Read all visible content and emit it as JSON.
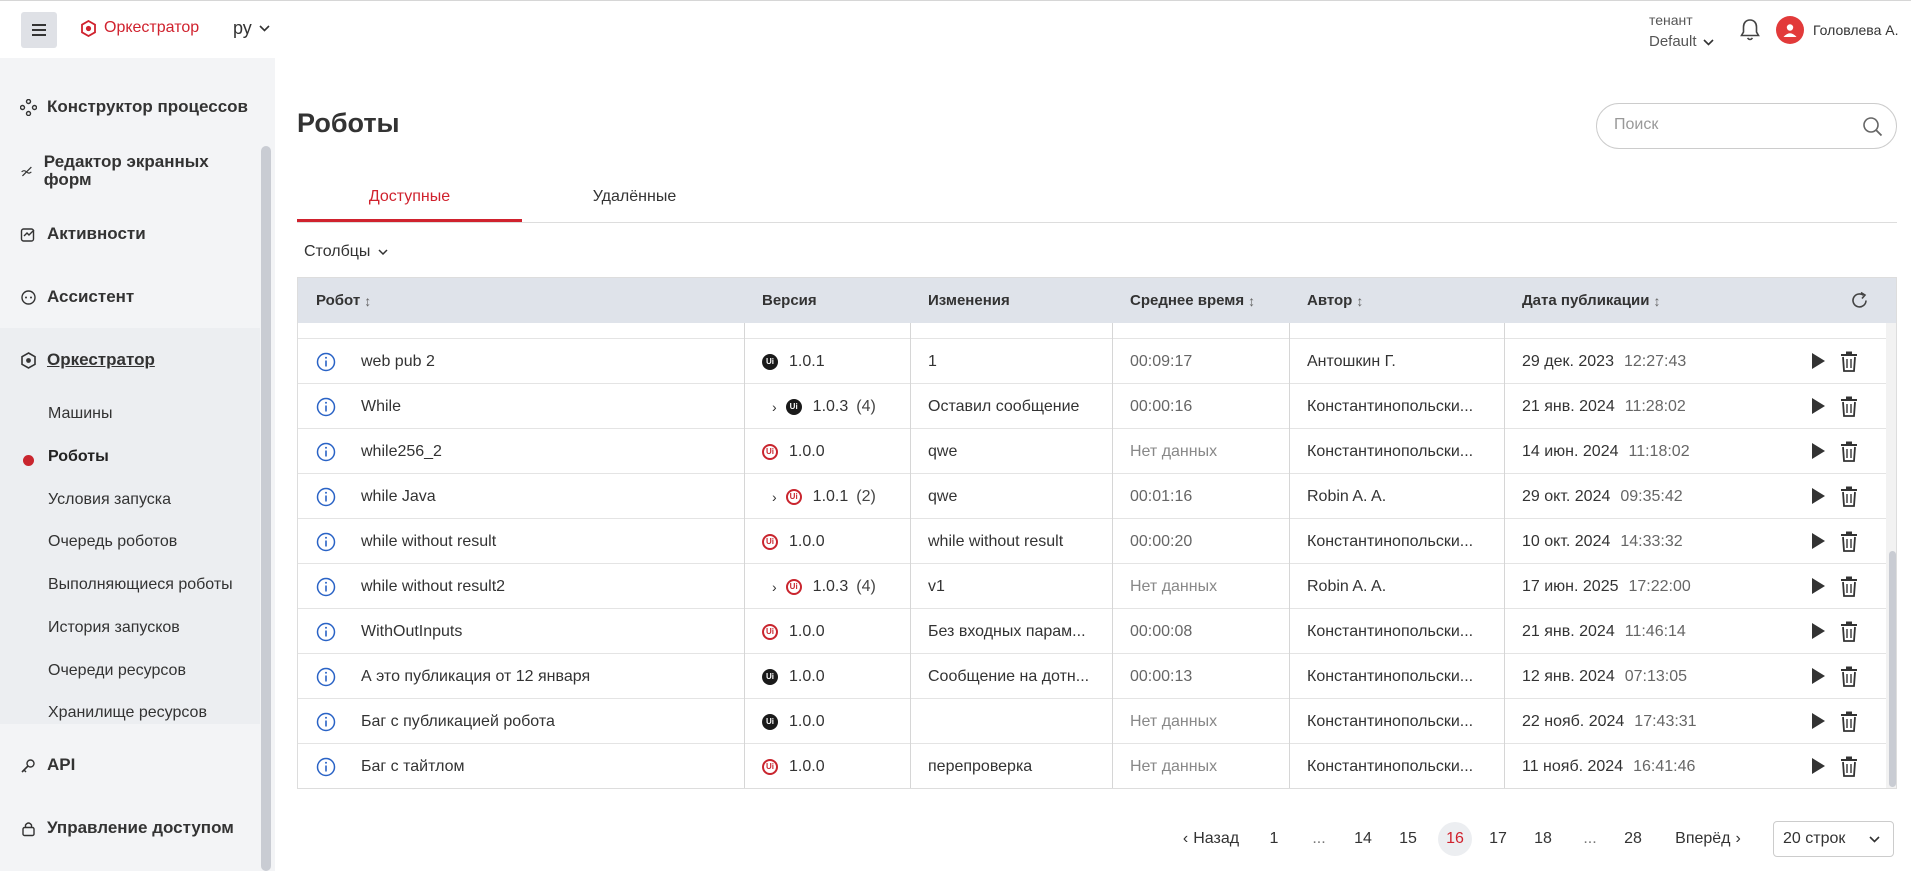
{
  "header": {
    "logo_text": "Оркестратор",
    "language": "ру",
    "tenant_label": "тенант",
    "tenant_value": "Default",
    "user_name": "Головлева А."
  },
  "sidebar": {
    "items": [
      {
        "label": "Конструктор процессов",
        "icon": "process-builder-icon"
      },
      {
        "label": "Редактор экранных форм",
        "icon": "form-editor-icon"
      },
      {
        "label": "Активности",
        "icon": "activity-icon"
      },
      {
        "label": "Ассистент",
        "icon": "assistant-icon"
      },
      {
        "label": "Оркестратор",
        "icon": "orchestrator-icon"
      },
      {
        "label": "API",
        "icon": "api-icon"
      },
      {
        "label": "Управление доступом",
        "icon": "access-icon"
      }
    ],
    "orchestrator_sub": [
      "Машины",
      "Роботы",
      "Условия запуска",
      "Очередь роботов",
      "Выполняющиеся роботы",
      "История запусков",
      "Очереди ресурсов",
      "Хранилище ресурсов"
    ],
    "active_sub": "Роботы"
  },
  "main": {
    "title": "Роботы",
    "search_placeholder": "Поиск",
    "tabs": [
      "Доступные",
      "Удалённые"
    ],
    "columns_label": "Столбцы",
    "table_headers": [
      "Робот",
      "Версия",
      "Изменения",
      "Среднее время",
      "Автор",
      "Дата публикации"
    ],
    "rows": [
      {
        "name": "web pub 2",
        "badge": "dark",
        "version": "1.0.1",
        "count": "",
        "changes": "1",
        "avg": "00:09:17",
        "avg_muted": false,
        "author": "Антошкин Г.",
        "date": "29 дек. 2023",
        "time": "12:27:43"
      },
      {
        "name": "While",
        "badge": "dark",
        "version": "1.0.3",
        "count": "(4)",
        "changes": "Оставил сообщение",
        "avg": "00:00:16",
        "avg_muted": false,
        "author": "Константинопольски...",
        "date": "21 янв. 2024",
        "time": "11:28:02"
      },
      {
        "name": "while256_2",
        "badge": "red",
        "version": "1.0.0",
        "count": "",
        "changes": "qwe",
        "avg": "Нет данных",
        "avg_muted": true,
        "author": "Константинопольски...",
        "date": "14 июн. 2024",
        "time": "11:18:02"
      },
      {
        "name": "while Java",
        "badge": "red",
        "version": "1.0.1",
        "count": "(2)",
        "changes": "qwe",
        "avg": "00:01:16",
        "avg_muted": false,
        "author": "Robin A. A.",
        "date": "29 окт. 2024",
        "time": "09:35:42"
      },
      {
        "name": "while without result",
        "badge": "red",
        "version": "1.0.0",
        "count": "",
        "changes": "while without result",
        "avg": "00:00:20",
        "avg_muted": false,
        "author": "Константинопольски...",
        "date": "10 окт. 2024",
        "time": "14:33:32"
      },
      {
        "name": "while without result2",
        "badge": "red",
        "version": "1.0.3",
        "count": "(4)",
        "changes": "v1",
        "avg": "Нет данных",
        "avg_muted": true,
        "author": "Robin A. A.",
        "date": "17 июн. 2025",
        "time": "17:22:00"
      },
      {
        "name": "WithOutInputs",
        "badge": "red",
        "version": "1.0.0",
        "count": "",
        "changes": "Без входных парам...",
        "avg": "00:00:08",
        "avg_muted": false,
        "author": "Константинопольски...",
        "date": "21 янв. 2024",
        "time": "11:46:14"
      },
      {
        "name": "А это публикация от 12 января",
        "badge": "dark",
        "version": "1.0.0",
        "count": "",
        "changes": "Сообщение на дотн...",
        "avg": "00:00:13",
        "avg_muted": false,
        "author": "Константинопольски...",
        "date": "12 янв. 2024",
        "time": "07:13:05"
      },
      {
        "name": "Баг с публикацией робота",
        "badge": "dark",
        "version": "1.0.0",
        "count": "",
        "changes": "",
        "avg": "Нет данных",
        "avg_muted": true,
        "author": "Константинопольски...",
        "date": "22 нояб. 2024",
        "time": "17:43:31"
      },
      {
        "name": "Баг с тайтлом",
        "badge": "red",
        "version": "1.0.0",
        "count": "",
        "changes": "перепроверка",
        "avg": "Нет данных",
        "avg_muted": true,
        "author": "Константинопольски...",
        "date": "11 нояб. 2024",
        "time": "16:41:46"
      }
    ]
  },
  "pagination": {
    "prev": "Назад",
    "next": "Вперёд",
    "pages": [
      "1",
      "...",
      "14",
      "15",
      "16",
      "17",
      "18",
      "...",
      "28"
    ],
    "current": "16",
    "rows_per_page": "20 строк"
  },
  "colors": {
    "accent": "#d0222e",
    "header_bg": "#dfe3ea",
    "info_icon": "#2a63c6"
  }
}
